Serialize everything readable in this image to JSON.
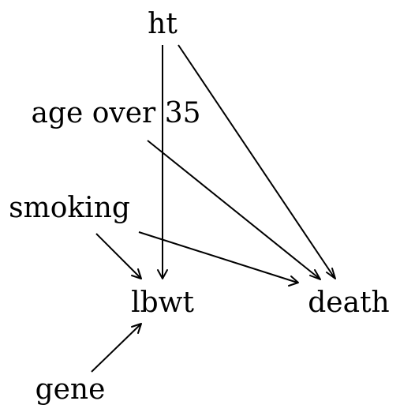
{
  "nodes": {
    "ht": "ht",
    "age_over_35": "age over 35",
    "smoking": "smoking",
    "lbwt": "lbwt",
    "death": "death",
    "gene": "gene"
  },
  "edges": [
    {
      "from": "ht",
      "to": "lbwt"
    },
    {
      "from": "ht",
      "to": "death"
    },
    {
      "from": "age over 35",
      "to": "death"
    },
    {
      "from": "smoking",
      "to": "lbwt"
    },
    {
      "from": "smoking",
      "to": "death"
    },
    {
      "from": "gene",
      "to": "lbwt"
    }
  ]
}
